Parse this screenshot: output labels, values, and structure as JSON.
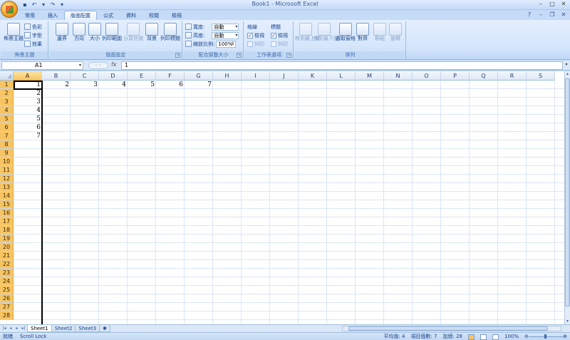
{
  "window": {
    "title": "Book1 - Microsoft Excel"
  },
  "quick_access": {
    "save_icon": "save-icon",
    "undo_icon": "undo-icon",
    "redo_icon": "redo-icon"
  },
  "tabs": [
    {
      "label": "常用"
    },
    {
      "label": "插入"
    },
    {
      "label": "版面配置",
      "active": true
    },
    {
      "label": "公式"
    },
    {
      "label": "資料"
    },
    {
      "label": "校閱"
    },
    {
      "label": "檢視"
    }
  ],
  "ribbon": {
    "themes": {
      "label": "佈景主題",
      "main_button": "佈景主題",
      "colors": "色彩",
      "fonts": "字型",
      "effects": "效果"
    },
    "page_setup": {
      "label": "版面設定",
      "margins": "邊界",
      "orientation": "方向",
      "size": "大小",
      "print_area": "列印範圍",
      "breaks": "分頁符號",
      "background": "背景",
      "print_titles": "列印標題"
    },
    "scale": {
      "label": "配合調整大小",
      "width_label": "寬度:",
      "width_value": "自動",
      "height_label": "高度:",
      "height_value": "自動",
      "scale_label": "縮放比例:",
      "scale_value": "100%"
    },
    "sheet_options": {
      "label": "工作表選項",
      "gridlines": "格線",
      "headings": "標題",
      "view": "檢視",
      "print": "列印"
    },
    "arrange": {
      "label": "排列",
      "bring_forward": "移到最上層",
      "send_backward": "移到最下層",
      "selection_pane": "選取窗格",
      "align": "對齊",
      "group": "群組",
      "rotate": "旋轉"
    }
  },
  "formula_bar": {
    "name_box": "A1",
    "fx": "fx",
    "value": "1"
  },
  "grid": {
    "columns": [
      "A",
      "B",
      "C",
      "D",
      "E",
      "F",
      "G",
      "H",
      "I",
      "J",
      "K",
      "L",
      "M",
      "N",
      "O",
      "P",
      "Q",
      "R",
      "S"
    ],
    "rows": [
      "1",
      "2",
      "3",
      "4",
      "5",
      "6",
      "7",
      "8",
      "9",
      "10",
      "11",
      "12",
      "13",
      "14",
      "15",
      "16",
      "17",
      "18",
      "19",
      "20",
      "21",
      "22",
      "23",
      "24",
      "25",
      "26",
      "27",
      "28"
    ],
    "cells": [
      {
        "col": "A",
        "row": "1",
        "value": "1"
      },
      {
        "col": "B",
        "row": "1",
        "value": "2"
      },
      {
        "col": "C",
        "row": "1",
        "value": "3"
      },
      {
        "col": "D",
        "row": "1",
        "value": "4"
      },
      {
        "col": "E",
        "row": "1",
        "value": "5"
      },
      {
        "col": "F",
        "row": "1",
        "value": "6"
      },
      {
        "col": "G",
        "row": "1",
        "value": "7"
      },
      {
        "col": "A",
        "row": "2",
        "value": "2"
      },
      {
        "col": "A",
        "row": "3",
        "value": "3"
      },
      {
        "col": "A",
        "row": "4",
        "value": "4"
      },
      {
        "col": "A",
        "row": "5",
        "value": "5"
      },
      {
        "col": "A",
        "row": "6",
        "value": "6"
      },
      {
        "col": "A",
        "row": "7",
        "value": "7"
      }
    ],
    "selected_column": "A",
    "selected_rows_end": "28"
  },
  "sheets": [
    "Sheet1",
    "Sheet2",
    "Sheet3"
  ],
  "active_sheet": "Sheet1",
  "status": {
    "mode": "就緒",
    "scroll_lock": "Scroll Lock",
    "average": "平均值: 4",
    "count": "項目個數: 7",
    "sum": "加總: 28",
    "zoom": "100%"
  }
}
